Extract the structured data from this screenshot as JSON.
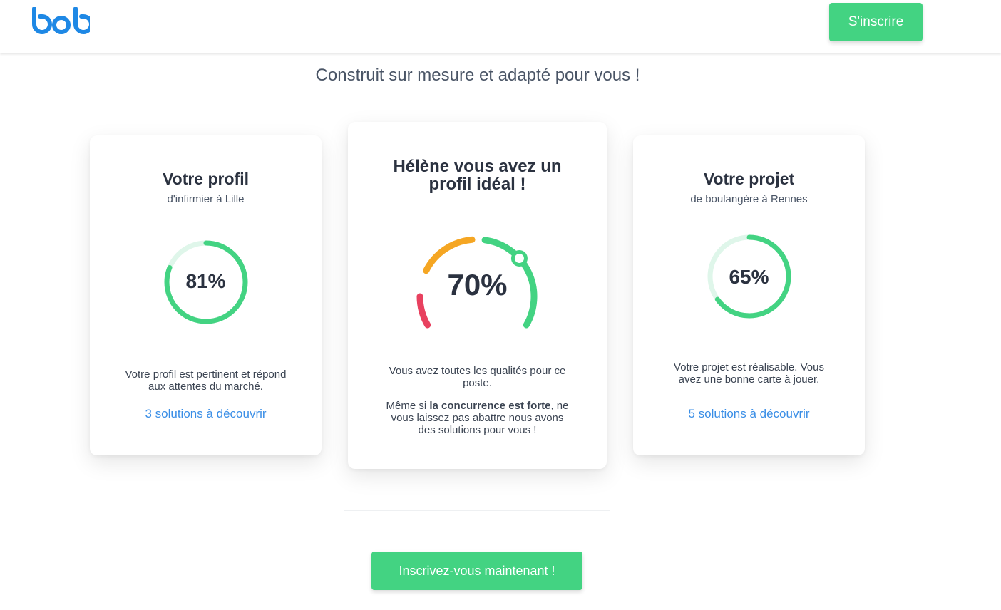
{
  "header": {
    "logo_text": "bob",
    "signup_label": "S'inscrire"
  },
  "subtitle": "Construit sur mesure et adapté pour vous !",
  "cards": {
    "profile": {
      "title": "Votre profil",
      "subtitle": "d'infirmier à Lille",
      "percent_label": "81%",
      "percent": 81,
      "text": "Votre profil est pertinent et répond aux attentes du marché.",
      "link": "3 solutions à découvrir"
    },
    "match": {
      "title": "Hélène vous avez un profil idéal !",
      "percent_label": "70%",
      "percent": 70,
      "text_1": "Vous avez toutes les qualités pour ce poste.",
      "text_2_before": "Même si ",
      "text_2_bold": "la concurrence est forte",
      "text_2_after": ", ne vous laissez pas abattre nous avons des solutions pour vous !"
    },
    "project": {
      "title": "Votre projet",
      "subtitle": "de boulangère à Rennes",
      "percent_label": "65%",
      "percent": 65,
      "text": "Votre projet est réalisable. Vous avez une bonne carte à jouer.",
      "link": "5 solutions à découvrir"
    }
  },
  "cta_label": "Inscrivez-vous maintenant !",
  "colors": {
    "brand_blue": "#1e88e5",
    "green": "#43d382",
    "green_light": "#dff6ea",
    "orange": "#f5a623",
    "red": "#e8415f",
    "link": "#3a8ee6"
  }
}
